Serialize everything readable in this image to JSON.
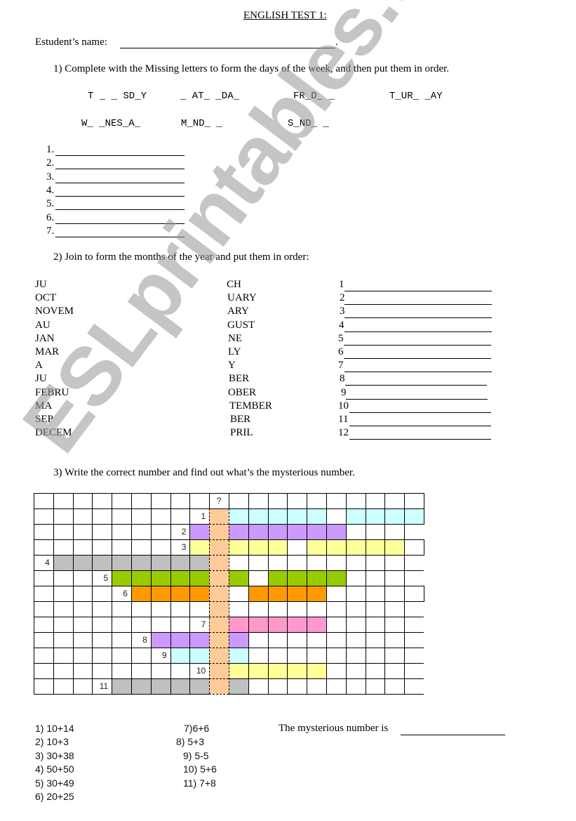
{
  "title": "ENGLISH TEST 1:",
  "student": {
    "label": "Estudent’s name:",
    "end": "."
  },
  "q1": {
    "instruction": "1)   Complete with the Missing letters to form the days of the week, and then put them in order.",
    "words_row1": [
      "T _ _ SD_Y",
      "_ AT_ _DA_",
      "FR_D_ _",
      "T_UR_ _AY"
    ],
    "words_row2": [
      "W_ _NES_A_",
      "M_ND_ _",
      "S_ND_ _"
    ],
    "answers": [
      "1.",
      "2.",
      "3.",
      "4.",
      "5.",
      "6.",
      "7."
    ]
  },
  "q2": {
    "instruction": "2)   Join to form the months of the year and put them in order:",
    "left": [
      "JU",
      "OCT",
      "NOVEM",
      "AU",
      "JAN",
      "MAR",
      "A",
      "JU",
      "FEBRU",
      "MA",
      "SEP",
      "DECEM"
    ],
    "right": [
      "CH",
      "UARY",
      "ARY",
      "GUST",
      "NE",
      "LY",
      "Y",
      "BER",
      "OBER",
      "TEMBER",
      "BER",
      "PRIL"
    ],
    "numbers": [
      "1",
      "2",
      "3",
      "4",
      "5",
      "6",
      "7",
      "8",
      "9",
      "10",
      "11",
      "12"
    ]
  },
  "q3": {
    "instruction": "3)   Write the correct number and find out what’s the mysterious number.",
    "grid": {
      "cols": 20,
      "rows": 13,
      "mystery_col": 9,
      "mystery_label": "?",
      "colors": {
        "cyan": "#ccffff",
        "purple": "#cc99ff",
        "yellow": "#ffff99",
        "gray": "#c0c0c0",
        "green": "#99cc00",
        "orange": "#ff9900",
        "pink": "#ff99cc",
        "peach": "#ffcc99"
      },
      "row_specs": [
        {
          "label": "",
          "label_col": null,
          "color": null,
          "cells": [],
          "right_border": true
        },
        {
          "label": "1",
          "label_col": 8,
          "color": "cyan",
          "cells": [
            10,
            11,
            12,
            13,
            14,
            16,
            17,
            18,
            19
          ],
          "right_border": true
        },
        {
          "label": "2",
          "label_col": 7,
          "color": "purple",
          "cells": [
            8,
            10,
            11,
            12,
            13,
            14,
            15
          ],
          "right_border": false
        },
        {
          "label": "3",
          "label_col": 7,
          "color": "yellow",
          "cells": [
            8,
            10,
            11,
            12,
            14,
            15,
            16,
            17,
            18
          ],
          "right_border": true
        },
        {
          "label": "4",
          "label_col": 0,
          "color": "gray",
          "cells": [
            1,
            2,
            3,
            4,
            5,
            6,
            7,
            8
          ],
          "right_border": false
        },
        {
          "label": "5",
          "label_col": 3,
          "color": "green",
          "cells": [
            4,
            5,
            6,
            7,
            8,
            10,
            12,
            13,
            14,
            15
          ],
          "right_border": false
        },
        {
          "label": "6",
          "label_col": 4,
          "color": "orange",
          "cells": [
            5,
            6,
            7,
            8,
            11,
            12,
            13,
            14
          ],
          "right_border": true
        },
        {
          "label": "",
          "label_col": null,
          "color": null,
          "cells": [],
          "right_border": false
        },
        {
          "label": "7",
          "label_col": 8,
          "color": "pink",
          "cells": [
            10,
            11,
            12,
            13,
            14
          ],
          "right_border": false
        },
        {
          "label": "8",
          "label_col": 5,
          "color": "purple",
          "cells": [
            6,
            7,
            8,
            10
          ],
          "right_border": false
        },
        {
          "label": "9",
          "label_col": 6,
          "color": "cyan",
          "cells": [
            7,
            8,
            10
          ],
          "right_border": false
        },
        {
          "label": "10",
          "label_col": 8,
          "color": "yellow",
          "cells": [
            10,
            11,
            12,
            13,
            14
          ],
          "right_border": false
        },
        {
          "label": "11",
          "label_col": 3,
          "color": "gray",
          "cells": [
            4,
            5,
            6,
            7,
            8,
            10
          ],
          "right_border": false
        }
      ]
    },
    "sums_left": [
      "1) 10+14",
      "2) 10+3",
      "3) 30+38",
      "4) 50+50",
      "5) 30+49",
      "6) 20+25"
    ],
    "sums_right": [
      "7)6+6",
      "8) 5+3",
      "9) 5-5",
      "10) 5+6",
      "11) 7+8"
    ],
    "mystery_label": "The mysterious number is"
  },
  "watermark": "ESLprintables.com"
}
